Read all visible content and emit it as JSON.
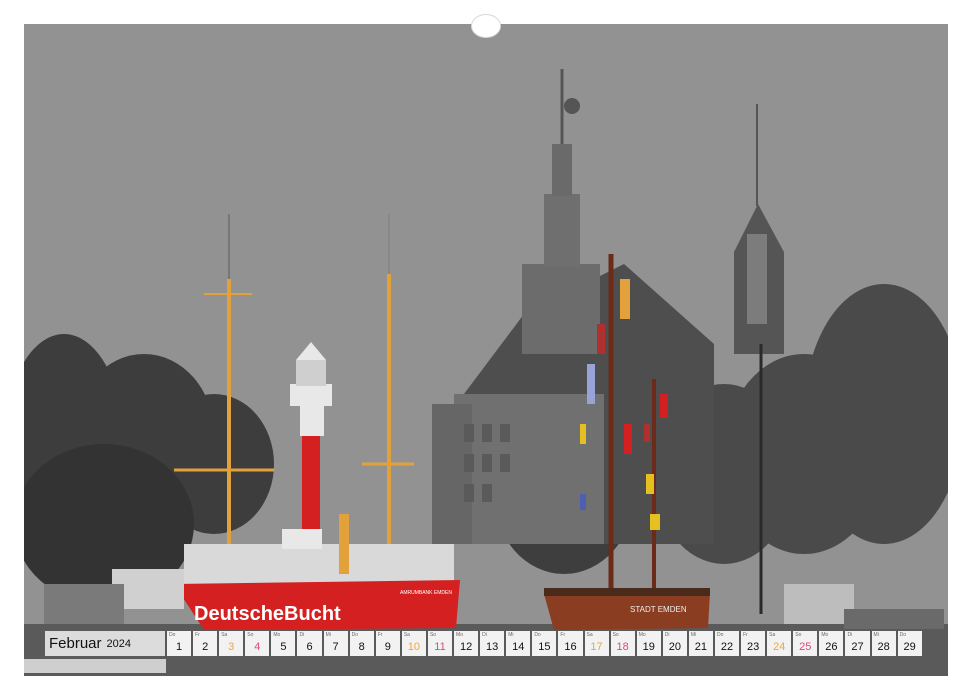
{
  "calendar": {
    "month": "Februar",
    "year": "2024",
    "days": [
      {
        "dow": "Do",
        "num": "1",
        "kind": "weekday"
      },
      {
        "dow": "Fr",
        "num": "2",
        "kind": "weekday"
      },
      {
        "dow": "Sa",
        "num": "3",
        "kind": "sat"
      },
      {
        "dow": "So",
        "num": "4",
        "kind": "sun"
      },
      {
        "dow": "Mo",
        "num": "5",
        "kind": "weekday"
      },
      {
        "dow": "Di",
        "num": "6",
        "kind": "weekday"
      },
      {
        "dow": "Mi",
        "num": "7",
        "kind": "weekday"
      },
      {
        "dow": "Do",
        "num": "8",
        "kind": "weekday"
      },
      {
        "dow": "Fr",
        "num": "9",
        "kind": "weekday"
      },
      {
        "dow": "Sa",
        "num": "10",
        "kind": "sat"
      },
      {
        "dow": "So",
        "num": "11",
        "kind": "sun"
      },
      {
        "dow": "Mo",
        "num": "12",
        "kind": "weekday"
      },
      {
        "dow": "Di",
        "num": "13",
        "kind": "weekday"
      },
      {
        "dow": "Mi",
        "num": "14",
        "kind": "weekday"
      },
      {
        "dow": "Do",
        "num": "15",
        "kind": "weekday"
      },
      {
        "dow": "Fr",
        "num": "16",
        "kind": "weekday"
      },
      {
        "dow": "Sa",
        "num": "17",
        "kind": "sat"
      },
      {
        "dow": "So",
        "num": "18",
        "kind": "sun"
      },
      {
        "dow": "Mo",
        "num": "19",
        "kind": "weekday"
      },
      {
        "dow": "Di",
        "num": "20",
        "kind": "weekday"
      },
      {
        "dow": "Mi",
        "num": "21",
        "kind": "weekday"
      },
      {
        "dow": "Do",
        "num": "22",
        "kind": "weekday"
      },
      {
        "dow": "Fr",
        "num": "23",
        "kind": "weekday"
      },
      {
        "dow": "Sa",
        "num": "24",
        "kind": "sat"
      },
      {
        "dow": "So",
        "num": "25",
        "kind": "sun"
      },
      {
        "dow": "Mo",
        "num": "26",
        "kind": "weekday"
      },
      {
        "dow": "Di",
        "num": "27",
        "kind": "weekday"
      },
      {
        "dow": "Mi",
        "num": "28",
        "kind": "weekday"
      },
      {
        "dow": "Do",
        "num": "29",
        "kind": "weekday"
      }
    ]
  },
  "photo": {
    "ship_name": "DeutscheBucht",
    "ship_subtitle": "AMRUMBANK EMDEN",
    "second_ship_name": "STADT EMDEN",
    "colors": {
      "sky": "#929292",
      "ship_red": "#d42020",
      "mast_orange": "#e2a13a",
      "hull_brown": "#8a3d20"
    }
  }
}
